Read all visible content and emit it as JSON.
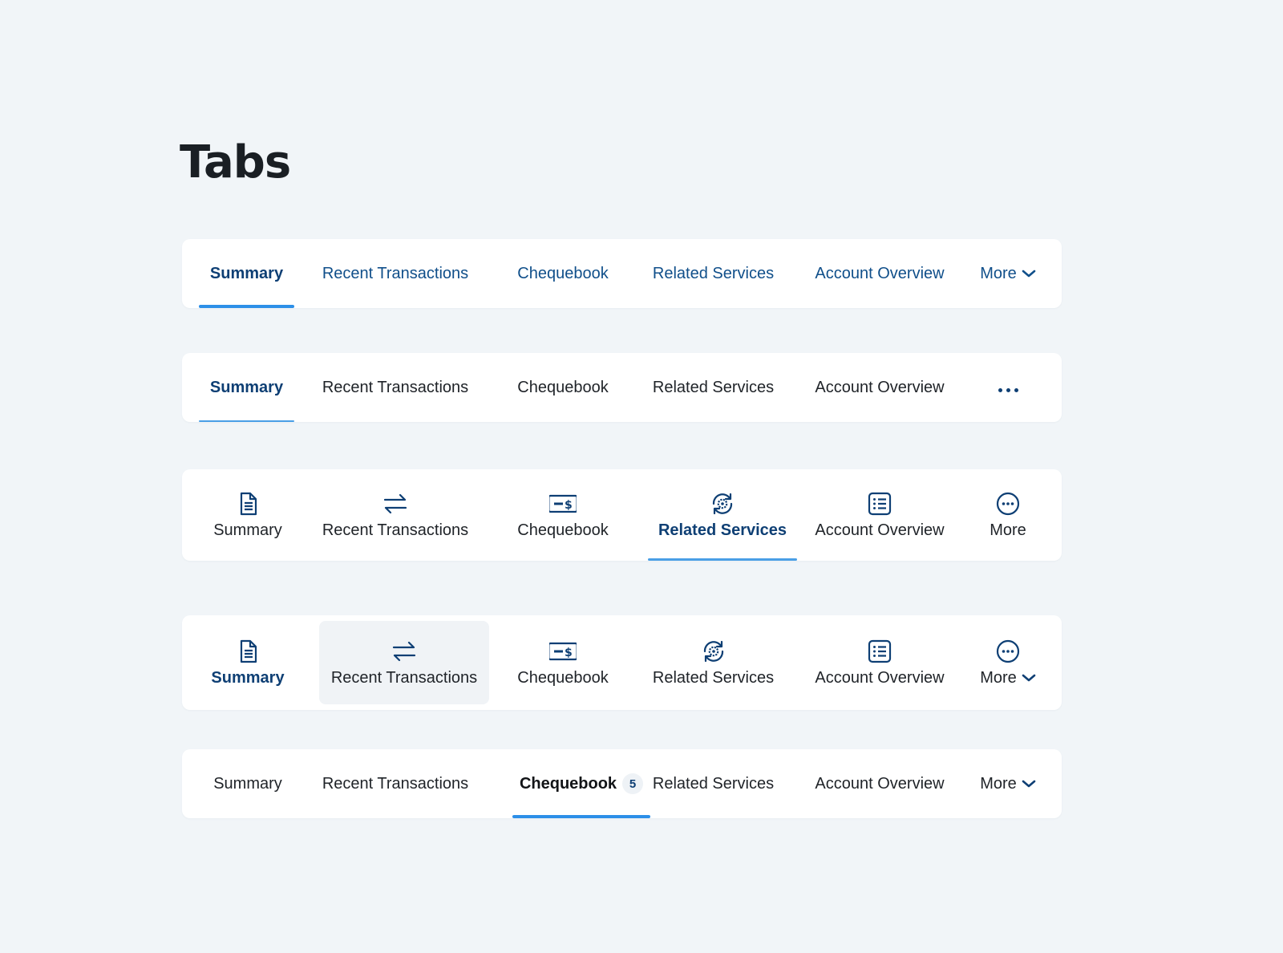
{
  "page": {
    "title": "Tabs"
  },
  "colors": {
    "accent": "#2c8fe8",
    "text_blue": "#104f8a",
    "active_blue": "#0e3f74",
    "background": "#f1f5f8"
  },
  "bar1": {
    "tabs": [
      "Summary",
      "Recent Transactions",
      "Chequebook",
      "Related Services",
      "Account Overview"
    ],
    "active": "Summary",
    "more_label": "More",
    "more_icon": "chevron-down-icon"
  },
  "bar2": {
    "tabs": [
      "Summary",
      "Recent Transactions",
      "Chequebook",
      "Related Services",
      "Account Overview"
    ],
    "active": "Summary",
    "overflow_icon": "ellipsis-icon"
  },
  "bar3": {
    "tabs": [
      {
        "label": "Summary",
        "icon": "document-icon"
      },
      {
        "label": "Recent Transactions",
        "icon": "transfer-arrows-icon"
      },
      {
        "label": "Chequebook",
        "icon": "cheque-icon"
      },
      {
        "label": "Related Services",
        "icon": "gear-refresh-icon"
      },
      {
        "label": "Account Overview",
        "icon": "list-icon"
      },
      {
        "label": "More",
        "icon": "more-circle-icon"
      }
    ],
    "active": "Related Services"
  },
  "bar4": {
    "tabs": [
      {
        "label": "Summary",
        "icon": "document-icon"
      },
      {
        "label": "Recent Transactions",
        "icon": "transfer-arrows-icon"
      },
      {
        "label": "Chequebook",
        "icon": "cheque-icon"
      },
      {
        "label": "Related Services",
        "icon": "gear-refresh-icon"
      },
      {
        "label": "Account Overview",
        "icon": "list-icon"
      },
      {
        "label": "More",
        "icon": "more-circle-icon"
      }
    ],
    "active": "Summary",
    "hovered": "Recent Transactions"
  },
  "bar5": {
    "tabs": [
      "Summary",
      "Recent Transactions",
      "Chequebook",
      "Related Services",
      "Account Overview"
    ],
    "active": "Chequebook",
    "badge": "5",
    "more_label": "More"
  }
}
